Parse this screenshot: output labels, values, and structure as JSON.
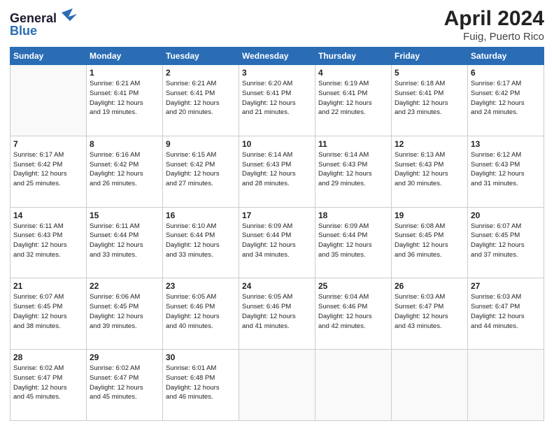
{
  "header": {
    "logo_line1": "General",
    "logo_line2": "Blue",
    "month": "April 2024",
    "location": "Fuig, Puerto Rico"
  },
  "days_of_week": [
    "Sunday",
    "Monday",
    "Tuesday",
    "Wednesday",
    "Thursday",
    "Friday",
    "Saturday"
  ],
  "weeks": [
    [
      {
        "day": "",
        "info": ""
      },
      {
        "day": "1",
        "info": "Sunrise: 6:21 AM\nSunset: 6:41 PM\nDaylight: 12 hours\nand 19 minutes."
      },
      {
        "day": "2",
        "info": "Sunrise: 6:21 AM\nSunset: 6:41 PM\nDaylight: 12 hours\nand 20 minutes."
      },
      {
        "day": "3",
        "info": "Sunrise: 6:20 AM\nSunset: 6:41 PM\nDaylight: 12 hours\nand 21 minutes."
      },
      {
        "day": "4",
        "info": "Sunrise: 6:19 AM\nSunset: 6:41 PM\nDaylight: 12 hours\nand 22 minutes."
      },
      {
        "day": "5",
        "info": "Sunrise: 6:18 AM\nSunset: 6:41 PM\nDaylight: 12 hours\nand 23 minutes."
      },
      {
        "day": "6",
        "info": "Sunrise: 6:17 AM\nSunset: 6:42 PM\nDaylight: 12 hours\nand 24 minutes."
      }
    ],
    [
      {
        "day": "7",
        "info": "Sunrise: 6:17 AM\nSunset: 6:42 PM\nDaylight: 12 hours\nand 25 minutes."
      },
      {
        "day": "8",
        "info": "Sunrise: 6:16 AM\nSunset: 6:42 PM\nDaylight: 12 hours\nand 26 minutes."
      },
      {
        "day": "9",
        "info": "Sunrise: 6:15 AM\nSunset: 6:42 PM\nDaylight: 12 hours\nand 27 minutes."
      },
      {
        "day": "10",
        "info": "Sunrise: 6:14 AM\nSunset: 6:43 PM\nDaylight: 12 hours\nand 28 minutes."
      },
      {
        "day": "11",
        "info": "Sunrise: 6:14 AM\nSunset: 6:43 PM\nDaylight: 12 hours\nand 29 minutes."
      },
      {
        "day": "12",
        "info": "Sunrise: 6:13 AM\nSunset: 6:43 PM\nDaylight: 12 hours\nand 30 minutes."
      },
      {
        "day": "13",
        "info": "Sunrise: 6:12 AM\nSunset: 6:43 PM\nDaylight: 12 hours\nand 31 minutes."
      }
    ],
    [
      {
        "day": "14",
        "info": "Sunrise: 6:11 AM\nSunset: 6:43 PM\nDaylight: 12 hours\nand 32 minutes."
      },
      {
        "day": "15",
        "info": "Sunrise: 6:11 AM\nSunset: 6:44 PM\nDaylight: 12 hours\nand 33 minutes."
      },
      {
        "day": "16",
        "info": "Sunrise: 6:10 AM\nSunset: 6:44 PM\nDaylight: 12 hours\nand 33 minutes."
      },
      {
        "day": "17",
        "info": "Sunrise: 6:09 AM\nSunset: 6:44 PM\nDaylight: 12 hours\nand 34 minutes."
      },
      {
        "day": "18",
        "info": "Sunrise: 6:09 AM\nSunset: 6:44 PM\nDaylight: 12 hours\nand 35 minutes."
      },
      {
        "day": "19",
        "info": "Sunrise: 6:08 AM\nSunset: 6:45 PM\nDaylight: 12 hours\nand 36 minutes."
      },
      {
        "day": "20",
        "info": "Sunrise: 6:07 AM\nSunset: 6:45 PM\nDaylight: 12 hours\nand 37 minutes."
      }
    ],
    [
      {
        "day": "21",
        "info": "Sunrise: 6:07 AM\nSunset: 6:45 PM\nDaylight: 12 hours\nand 38 minutes."
      },
      {
        "day": "22",
        "info": "Sunrise: 6:06 AM\nSunset: 6:45 PM\nDaylight: 12 hours\nand 39 minutes."
      },
      {
        "day": "23",
        "info": "Sunrise: 6:05 AM\nSunset: 6:46 PM\nDaylight: 12 hours\nand 40 minutes."
      },
      {
        "day": "24",
        "info": "Sunrise: 6:05 AM\nSunset: 6:46 PM\nDaylight: 12 hours\nand 41 minutes."
      },
      {
        "day": "25",
        "info": "Sunrise: 6:04 AM\nSunset: 6:46 PM\nDaylight: 12 hours\nand 42 minutes."
      },
      {
        "day": "26",
        "info": "Sunrise: 6:03 AM\nSunset: 6:47 PM\nDaylight: 12 hours\nand 43 minutes."
      },
      {
        "day": "27",
        "info": "Sunrise: 6:03 AM\nSunset: 6:47 PM\nDaylight: 12 hours\nand 44 minutes."
      }
    ],
    [
      {
        "day": "28",
        "info": "Sunrise: 6:02 AM\nSunset: 6:47 PM\nDaylight: 12 hours\nand 45 minutes."
      },
      {
        "day": "29",
        "info": "Sunrise: 6:02 AM\nSunset: 6:47 PM\nDaylight: 12 hours\nand 45 minutes."
      },
      {
        "day": "30",
        "info": "Sunrise: 6:01 AM\nSunset: 6:48 PM\nDaylight: 12 hours\nand 46 minutes."
      },
      {
        "day": "",
        "info": ""
      },
      {
        "day": "",
        "info": ""
      },
      {
        "day": "",
        "info": ""
      },
      {
        "day": "",
        "info": ""
      }
    ]
  ]
}
